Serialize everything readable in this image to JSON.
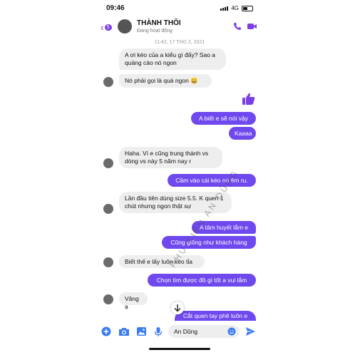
{
  "status_bar": {
    "time": "09:46",
    "network": "4G"
  },
  "header": {
    "unread_count": "5",
    "contact_name": "THÀNH THÔI",
    "contact_status": "Đang hoạt động"
  },
  "date_divider": "11:42, 17 THG 2, 2021",
  "messages": [
    {
      "from": "them",
      "text": "A ơi kéo của a kiểu gì đấy? Sao a quảng cáo nó ngon"
    },
    {
      "from": "them",
      "text": "Nó phải gọi là quá ngon 😀"
    },
    {
      "from": "me",
      "text": "A biết e sẽ nói vậy"
    },
    {
      "from": "me",
      "text": "Kaaaa"
    },
    {
      "from": "them",
      "text": "Haha. Vì e cũng trung thành vs dòng vs này 5 năm nay r"
    },
    {
      "from": "me",
      "text": "Cầm vào cái kéo nó êm ru."
    },
    {
      "from": "them",
      "text": "Lần đầu tiên dùng size 5.5. K quen 1 chút nhưng ngon thật sự"
    },
    {
      "from": "me",
      "text": "A tâm huyết lắm e"
    },
    {
      "from": "me",
      "text": "Cũng giống như khách hàng"
    },
    {
      "from": "them",
      "text": "Biết thế e lấy luôn kéo tỉa"
    },
    {
      "from": "me",
      "text": "Chọn tìm được đồ gì tốt a vui lắm"
    },
    {
      "from": "them",
      "text": "Vâng ạ"
    },
    {
      "from": "me",
      "text": "Cắt quen  tay phê luôn e"
    }
  ],
  "composer": {
    "input_value": "An Dũng"
  },
  "watermark": "PHỤ KIỆN AN DŨNG",
  "colors": {
    "accent": "#7b3fe4",
    "outgoing_bubble": "#7049ee",
    "incoming_bubble": "#eeeeee",
    "like": "#7b3fe4"
  }
}
